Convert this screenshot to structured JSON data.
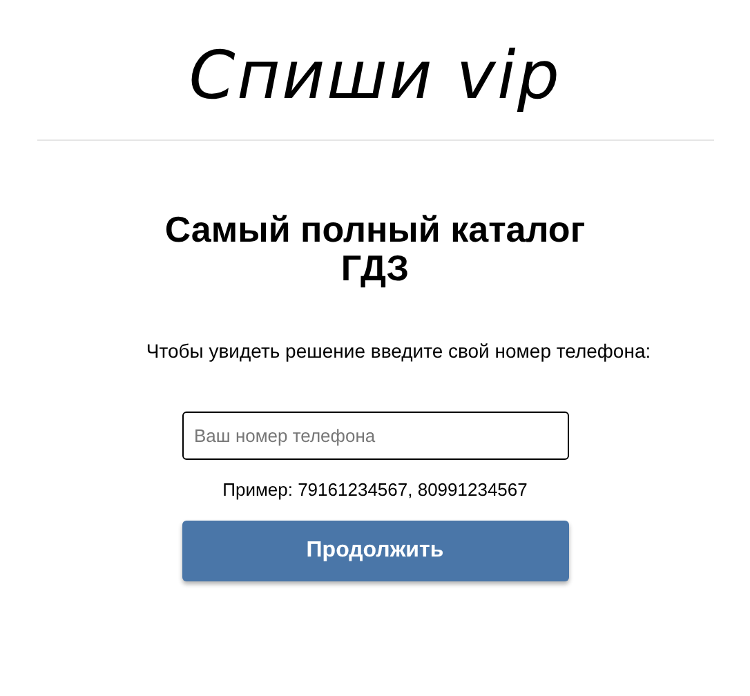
{
  "logo": "Спиши vip",
  "heading": "Самый полный каталог ГДЗ",
  "prompt": "Чтобы увидеть решение введите свой номер телефона:",
  "phone_field": {
    "placeholder": "Ваш номер телефона"
  },
  "example": "Пример: 79161234567, 80991234567",
  "submit_button": "Продолжить"
}
